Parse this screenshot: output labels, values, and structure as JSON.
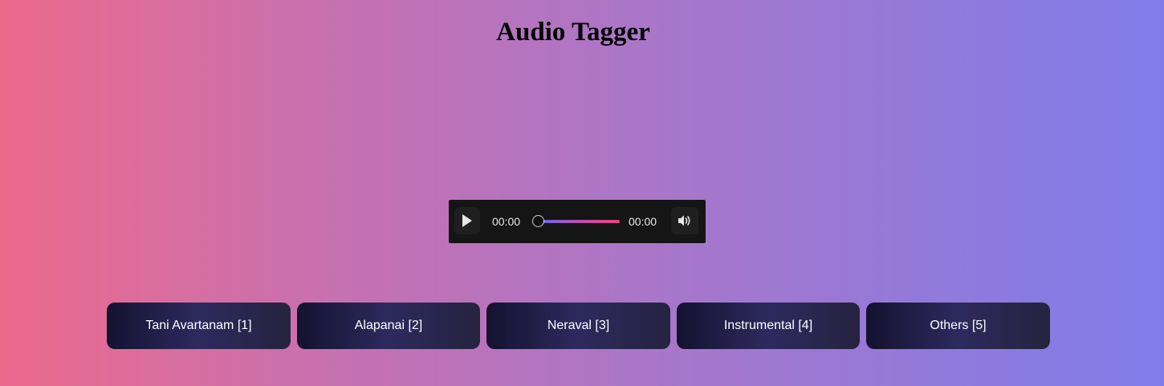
{
  "page": {
    "title": "Audio Tagger"
  },
  "player": {
    "current_time": "00:00",
    "total_time": "00:00",
    "progress": 0,
    "play_icon": "play-icon",
    "volume_icon": "volume-icon"
  },
  "tags": [
    {
      "label": "Tani Avartanam [1]"
    },
    {
      "label": "Alapanai [2]"
    },
    {
      "label": "Neraval [3]"
    },
    {
      "label": "Instrumental [4]"
    },
    {
      "label": "Others [5]"
    }
  ],
  "colors": {
    "background_start": "#eb6a8c",
    "background_end": "#7f7ce9",
    "player_bg": "#151515",
    "button_dark": "#141230",
    "button_mid": "#2d2a5e"
  }
}
